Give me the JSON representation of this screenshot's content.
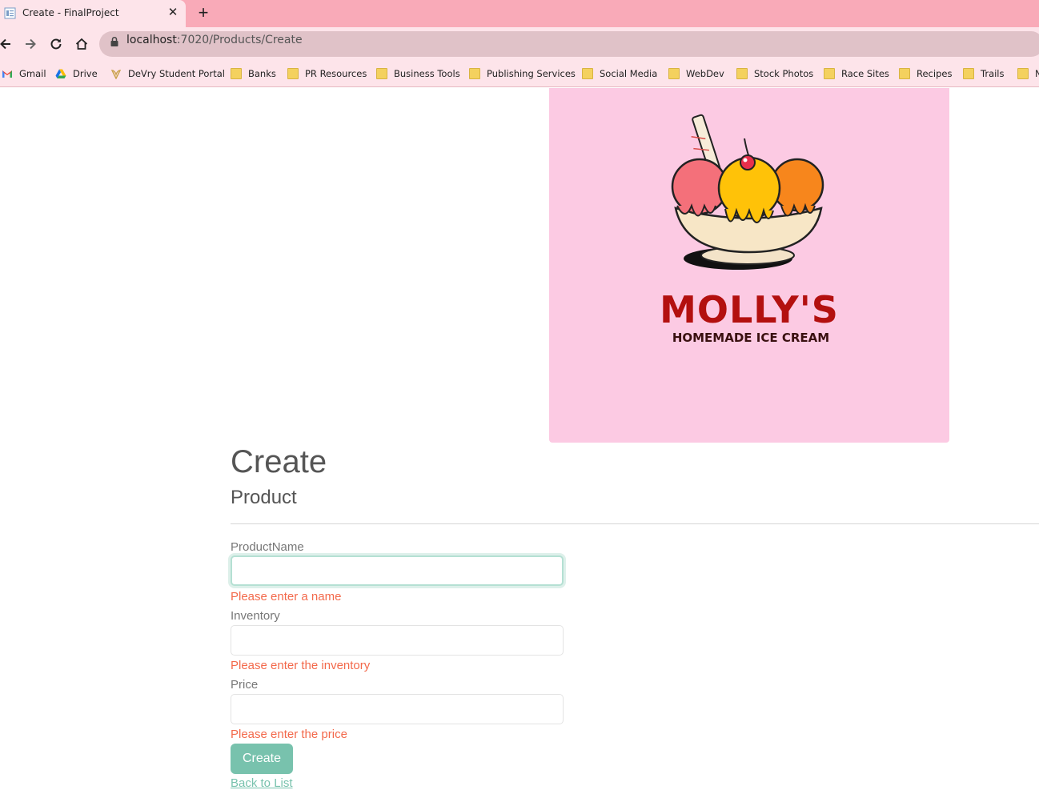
{
  "browser": {
    "tab": {
      "title": "Create - FinalProject",
      "close_glyph": "✕"
    },
    "new_tab_glyph": "+",
    "url": {
      "host": "localhost",
      "path": ":7020/Products/Create"
    },
    "bookmarks": [
      {
        "label": "Gmail",
        "icon": "gmail-icon"
      },
      {
        "label": "Drive",
        "icon": "drive-icon"
      },
      {
        "label": "DeVry Student Portal",
        "icon": "devry-icon"
      },
      {
        "label": "Banks",
        "icon": "folder-icon"
      },
      {
        "label": "PR Resources",
        "icon": "folder-icon"
      },
      {
        "label": "Business Tools",
        "icon": "folder-icon"
      },
      {
        "label": "Publishing Services",
        "icon": "folder-icon"
      },
      {
        "label": "Social Media",
        "icon": "folder-icon"
      },
      {
        "label": "WebDev",
        "icon": "folder-icon"
      },
      {
        "label": "Stock Photos",
        "icon": "folder-icon"
      },
      {
        "label": "Race Sites",
        "icon": "folder-icon"
      },
      {
        "label": "Recipes",
        "icon": "folder-icon"
      },
      {
        "label": "Trails",
        "icon": "folder-icon"
      },
      {
        "label": "N",
        "icon": "folder-icon"
      }
    ]
  },
  "banner": {
    "logo_title": "MOLLY'S",
    "logo_subtitle": "HOMEMADE ICE CREAM"
  },
  "page": {
    "title": "Create",
    "subtitle": "Product"
  },
  "form": {
    "fields": [
      {
        "label": "ProductName",
        "value": "",
        "error": "Please enter a name"
      },
      {
        "label": "Inventory",
        "value": "",
        "error": "Please enter the inventory"
      },
      {
        "label": "Price",
        "value": "",
        "error": "Please enter the price"
      }
    ],
    "submit_label": "Create",
    "back_link": "Back to List"
  },
  "colors": {
    "chrome_tabstrip": "#f9aab8",
    "chrome_toolbar": "#fde4ea",
    "banner_bg": "#fccae3",
    "primary": "#78c2ad",
    "error": "#f3694b",
    "logo_red": "#b3100f"
  }
}
